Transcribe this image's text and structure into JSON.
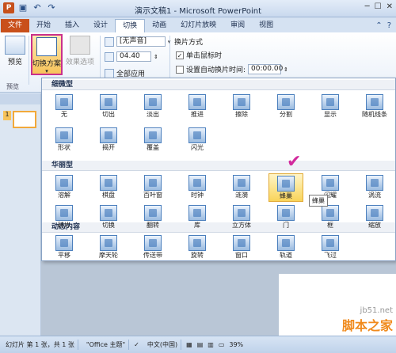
{
  "window": {
    "title": "演示文稿1 - Microsoft PowerPoint",
    "qat_icons": [
      "powerpoint-logo-icon",
      "save-icon",
      "undo-icon",
      "redo-icon"
    ],
    "controls": [
      "minimize",
      "maximize",
      "close"
    ]
  },
  "tabs": [
    {
      "label": "文件"
    },
    {
      "label": "开始"
    },
    {
      "label": "插入"
    },
    {
      "label": "设计"
    },
    {
      "label": "切换",
      "active": true
    },
    {
      "label": "动画"
    },
    {
      "label": "幻灯片放映"
    },
    {
      "label": "审阅"
    },
    {
      "label": "视图"
    }
  ],
  "ribbon": {
    "preview_label": "预览",
    "preview_group": "预览",
    "scheme_label": "切换方案",
    "effect_label": "效果选项",
    "sound_value": "[无声音]",
    "duration_value": "04.40",
    "apply_all_label": "全部应用",
    "switch_method_title": "换片方式",
    "on_click_label": "单击鼠标时",
    "on_click_checked": true,
    "auto_label": "设置自动换片时间:",
    "auto_value": "00:00.00"
  },
  "gallery": {
    "sections": [
      {
        "title": "细微型",
        "items": [
          "无",
          "切出",
          "淡出",
          "推进",
          "擦除",
          "分割",
          "显示",
          "随机线条",
          "形状",
          "揭开",
          "覆盖",
          "闪光"
        ]
      },
      {
        "title": "华丽型",
        "items": [
          "溶解",
          "棋盘",
          "百叶窗",
          "时钟",
          "涟漪",
          "蜂巢",
          "闪耀",
          "涡流",
          "碎片",
          "切换",
          "翻转",
          "库",
          "立方体",
          "门",
          "框",
          "缩放"
        ]
      },
      {
        "title": "动态内容",
        "items": [
          "平移",
          "摩天轮",
          "传送带",
          "旋转",
          "窗口",
          "轨道",
          "飞过"
        ]
      }
    ],
    "highlighted": "蜂巢",
    "tooltip": "蜂巢"
  },
  "slides_pane": {
    "slide_number": "1"
  },
  "status": {
    "slide_info": "幻灯片 第 1 张，共 1 张",
    "theme": "\"Office 主题\"",
    "language": "中文(中国)",
    "zoom": "39%"
  },
  "watermark": {
    "line1": "jb51.net",
    "line2": "脚本之家"
  }
}
